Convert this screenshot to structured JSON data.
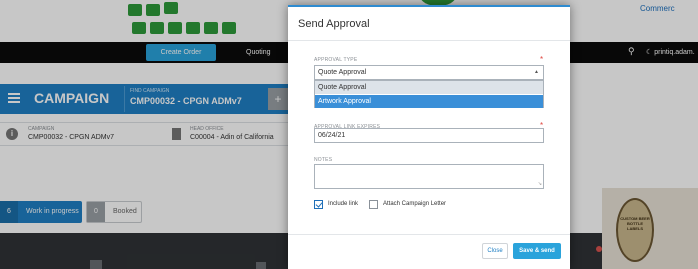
{
  "header": {
    "commerce_link": "Commerc",
    "brand_color": "#2e9a3a"
  },
  "navbar": {
    "create_order": "Create Order",
    "quoting": "Quoting",
    "user_name": "printiq.adam."
  },
  "campaign": {
    "section_title": "CAMPAIGN",
    "find_label": "FIND CAMPAIGN",
    "find_value": "CMP00032 - CPGN ADMv7",
    "add_symbol": "+"
  },
  "info": {
    "campaign_label": "CAMPAIGN",
    "campaign_value": "CMP00032 - CPGN ADMv7",
    "head_office_label": "HEAD OFFICE",
    "head_office_value": "C00004 - Adin of California"
  },
  "status": {
    "wip_count": "6",
    "wip_label": "Work in progress",
    "booked_count": "0",
    "booked_label": "Booked"
  },
  "product_label": {
    "text": "CUSTOM BEER BOTTLE LABELS"
  },
  "modal": {
    "title": "Send Approval",
    "approval_type_label": "APPROVAL TYPE",
    "approval_type_value": "Quote Approval",
    "options": [
      "Quote Approval",
      "Artwork Approval"
    ],
    "link_expires_label": "APPROVAL LINK EXPIRES",
    "link_expires_value": "06/24/21",
    "notes_label": "NOTES",
    "notes_value": "",
    "include_link_label": "Include link",
    "include_link_checked": true,
    "attach_letter_label": "Attach Campaign Letter",
    "attach_letter_checked": false,
    "required_mark": "*",
    "close_label": "Close",
    "send_label": "Save & send",
    "accent_color": "#2aa3db"
  }
}
